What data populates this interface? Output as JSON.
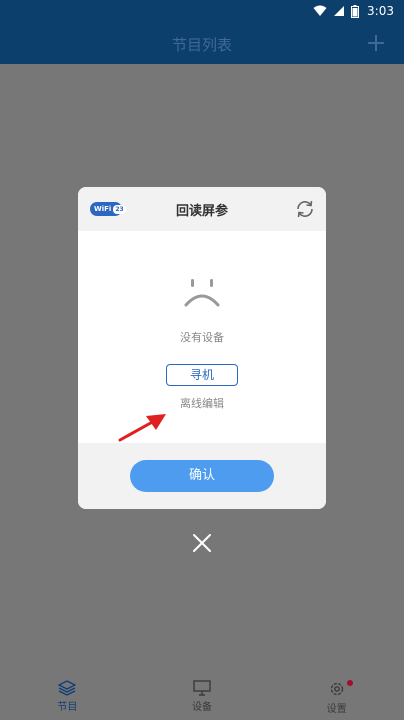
{
  "status_bar": {
    "time": "3:03"
  },
  "app_bar": {
    "title": "节目列表"
  },
  "dialog": {
    "wifi_badge": {
      "left": "WiFi",
      "right": "23"
    },
    "title": "回读屏参",
    "empty_message": "没有设备",
    "search_button": "寻机",
    "offline_edit": "离线编辑",
    "confirm_button": "确认"
  },
  "bottom_nav": {
    "items": [
      {
        "label": "节目",
        "icon": "layers-icon",
        "active": true
      },
      {
        "label": "设备",
        "icon": "monitor-icon",
        "active": false
      },
      {
        "label": "设置",
        "icon": "gear-icon",
        "active": false,
        "badge": true
      }
    ]
  },
  "colors": {
    "primary": "#0d3f6d",
    "accent_blue": "#4d9cf0",
    "badge_blue": "#2c68c0",
    "overlay_gray": "#777777",
    "annotation_red": "#e02020",
    "notification_dot": "#a0102a"
  }
}
